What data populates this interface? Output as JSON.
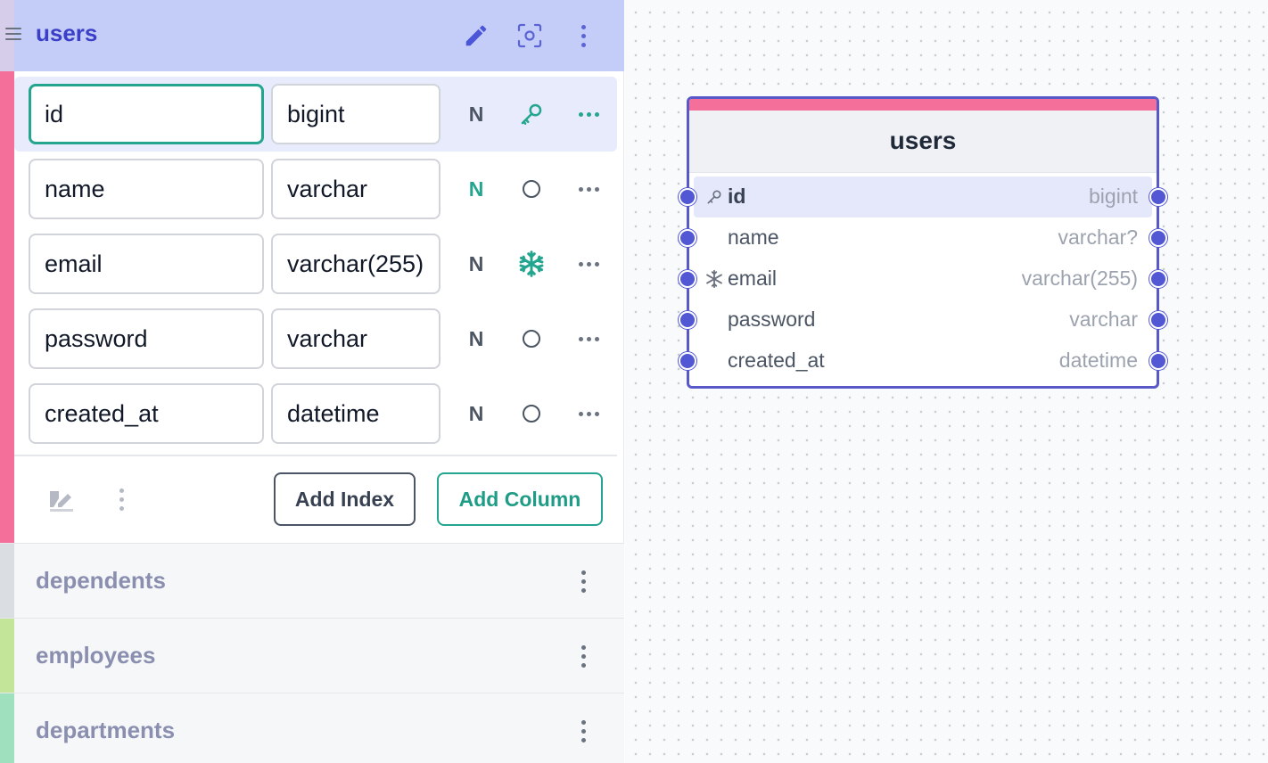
{
  "panel": {
    "table": {
      "name": "users",
      "color": "#f4709a",
      "header_actions": [
        "edit-icon",
        "focus-icon",
        "more-vertical-icon"
      ],
      "columns": [
        {
          "name": "id",
          "type": "bigint",
          "nullable_label": "N",
          "nullable": false,
          "badge": "primary-key-icon",
          "focused": true
        },
        {
          "name": "name",
          "type": "varchar",
          "nullable_label": "N",
          "nullable": true,
          "badge": "circle-icon",
          "focused": false
        },
        {
          "name": "email",
          "type": "varchar(255)",
          "nullable_label": "N",
          "nullable": false,
          "badge": "unique-snowflake-icon",
          "focused": false
        },
        {
          "name": "password",
          "type": "varchar",
          "nullable_label": "N",
          "nullable": false,
          "badge": "circle-icon",
          "focused": false
        },
        {
          "name": "created_at",
          "type": "datetime",
          "nullable_label": "N",
          "nullable": false,
          "badge": "circle-icon",
          "focused": false
        }
      ],
      "add_index_label": "Add Index",
      "add_column_label": "Add Column"
    },
    "other_tables": [
      {
        "name": "dependents",
        "color": "#dadde2"
      },
      {
        "name": "employees",
        "color": "#c2e59a"
      },
      {
        "name": "departments",
        "color": "#9fe0bf"
      }
    ]
  },
  "canvas": {
    "node": {
      "title": "users",
      "color": "#f4709a",
      "border_color": "#5858c9",
      "fields": [
        {
          "name": "id",
          "type": "bigint",
          "icon": "key-icon",
          "selected": true
        },
        {
          "name": "name",
          "type": "varchar?",
          "icon": "",
          "selected": false
        },
        {
          "name": "email",
          "type": "varchar(255)",
          "icon": "snowflake-icon",
          "selected": false
        },
        {
          "name": "password",
          "type": "varchar",
          "icon": "",
          "selected": false
        },
        {
          "name": "created_at",
          "type": "datetime",
          "icon": "",
          "selected": false
        }
      ]
    }
  },
  "colors": {
    "accent": "#23a58f",
    "primary": "#3b3fc7",
    "handle": "#5257d3"
  }
}
